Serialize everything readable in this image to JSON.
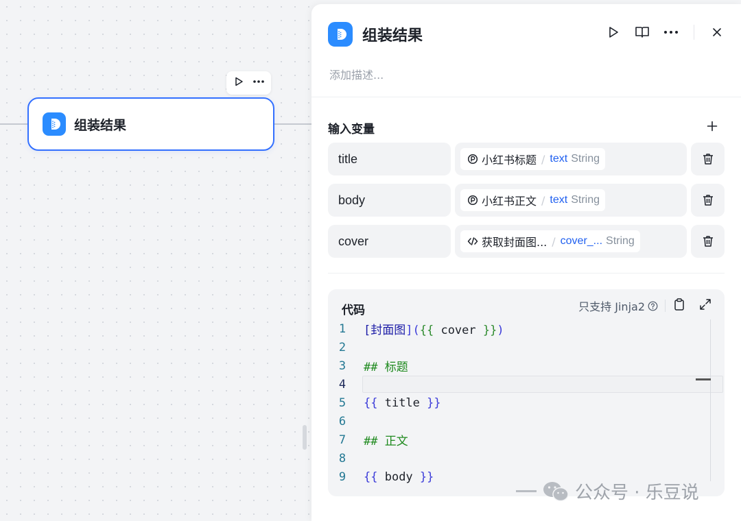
{
  "node": {
    "title": "组装结果"
  },
  "panel": {
    "title": "组装结果",
    "description_placeholder": "添加描述...",
    "inputs_section_title": "输入变量",
    "variables": [
      {
        "name": "title",
        "ref_node": "小红书标题",
        "ref_field": "text",
        "ref_type": "String",
        "ref_icon": "node-icon"
      },
      {
        "name": "body",
        "ref_node": "小红书正文",
        "ref_field": "text",
        "ref_type": "String",
        "ref_icon": "node-icon"
      },
      {
        "name": "cover",
        "ref_node": "获取封面图...",
        "ref_field": "cover_...",
        "ref_type": "String",
        "ref_icon": "code-icon"
      }
    ],
    "code": {
      "label": "代码",
      "support_text": "只支持 Jinja2",
      "line_numbers": [
        "1",
        "2",
        "3",
        "4",
        "5",
        "6",
        "7",
        "8",
        "9"
      ],
      "lines": {
        "l1": {
          "a": "[",
          "b": "封面图",
          "c": "](",
          "d": "{{",
          "e": " cover ",
          "f": "}}",
          "g": ")"
        },
        "l3": {
          "text": "## 标题"
        },
        "l5": {
          "a": "{{",
          "b": " title ",
          "c": "}}"
        },
        "l7": {
          "text": "## 正文"
        },
        "l9": {
          "a": "{{",
          "b": " body ",
          "c": "}}"
        }
      }
    }
  },
  "watermark": {
    "text": "公众号 · 乐豆说"
  },
  "colors": {
    "accent": "#3370ff",
    "brand_logo": "#2b8cff",
    "field_blue": "#2060f0"
  }
}
